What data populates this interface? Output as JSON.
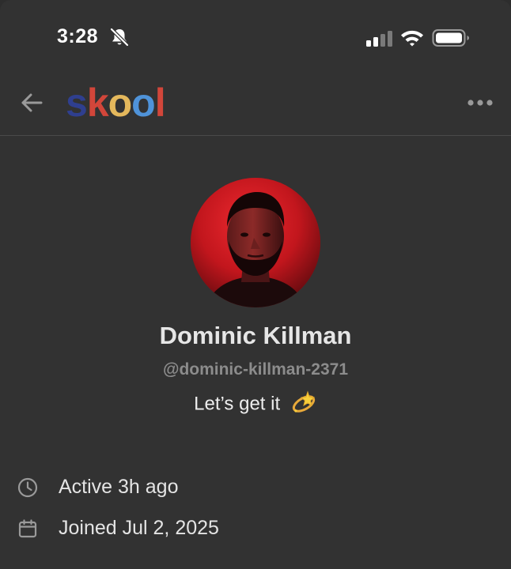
{
  "status_bar": {
    "time": "3:28",
    "icons": [
      "bell-slash-icon",
      "cellular-signal-icon",
      "wifi-icon",
      "battery-icon"
    ]
  },
  "header": {
    "logo_letters": [
      {
        "char": "s",
        "color": "#2f3f8f"
      },
      {
        "char": "k",
        "color": "#d2463a"
      },
      {
        "char": "o",
        "color": "#e4b85c"
      },
      {
        "char": "o",
        "color": "#4f93d9"
      },
      {
        "char": "l",
        "color": "#d2463a"
      }
    ],
    "back_icon": "arrow-left-icon",
    "menu_icon": "more-horizontal-icon"
  },
  "profile": {
    "name": "Dominic Killman",
    "handle": "@dominic-killman-2371",
    "bio": "Let’s get it",
    "bio_emoji": "dizzy-emoji",
    "avatar_bg": "#c8161d"
  },
  "details": {
    "active": "Active 3h ago",
    "joined": "Joined Jul 2, 2025"
  },
  "colors": {
    "background": "#323232",
    "primary_text": "#e6e6e6",
    "secondary_text": "#8c8c8c"
  }
}
